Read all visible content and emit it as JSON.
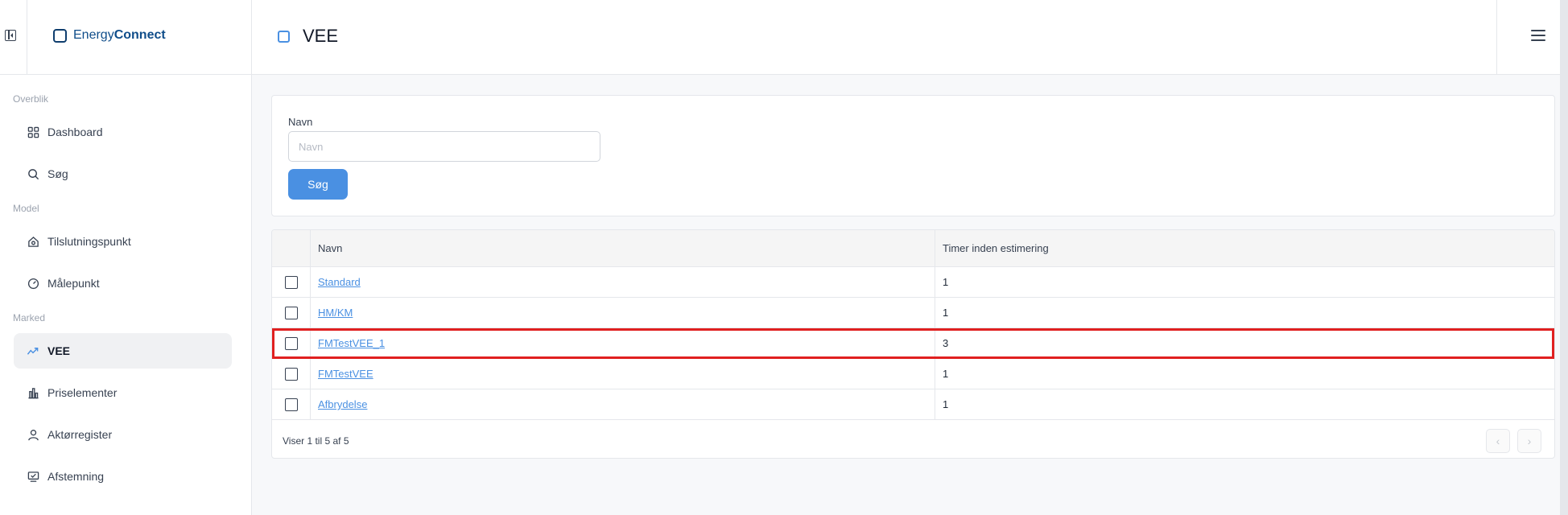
{
  "app": {
    "brand_part1": "Energy",
    "brand_part2": "Connect"
  },
  "header": {
    "title": "VEE"
  },
  "sidebar": {
    "sections": [
      {
        "label": "Overblik"
      },
      {
        "label": "Model"
      },
      {
        "label": "Marked"
      }
    ],
    "items": [
      {
        "label": "Dashboard",
        "icon": "grid-icon"
      },
      {
        "label": "Søg",
        "icon": "search-icon"
      },
      {
        "label": "Tilslutningspunkt",
        "icon": "house-icon"
      },
      {
        "label": "Målepunkt",
        "icon": "gauge-icon"
      },
      {
        "label": "VEE",
        "icon": "trend-icon",
        "active": true
      },
      {
        "label": "Priselementer",
        "icon": "bar-chart-icon"
      },
      {
        "label": "Aktørregister",
        "icon": "user-icon"
      },
      {
        "label": "Afstemning",
        "icon": "monitor-check-icon"
      }
    ]
  },
  "search": {
    "field_label": "Navn",
    "placeholder": "Navn",
    "value": "",
    "button_label": "Søg"
  },
  "table": {
    "columns": [
      "Navn",
      "Timer inden estimering"
    ],
    "rows": [
      {
        "name": "Standard",
        "timer": "1"
      },
      {
        "name": "HM/KM",
        "timer": "1"
      },
      {
        "name": "FMTestVEE_1",
        "timer": "3",
        "highlighted": true
      },
      {
        "name": "FMTestVEE",
        "timer": "1"
      },
      {
        "name": "Afbrydelse",
        "timer": "1"
      }
    ],
    "footer": "Viser 1 til 5 af 5",
    "prev_label": "‹",
    "next_label": "›"
  },
  "colors": {
    "accent": "#4a90e2",
    "highlight": "#e02020",
    "brand": "#0f4d8a"
  }
}
